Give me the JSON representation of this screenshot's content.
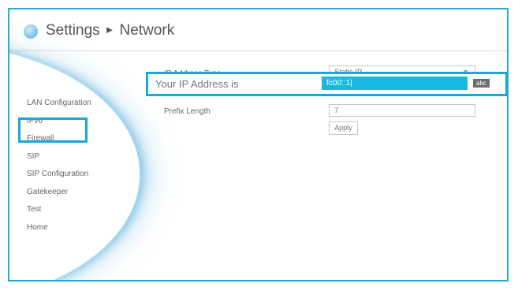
{
  "header": {
    "title": "Settings",
    "separator": "►",
    "section": "Network"
  },
  "menu": {
    "items": [
      {
        "label": "LAN Configuration"
      },
      {
        "label": "IPv6"
      },
      {
        "label": "Firewall"
      },
      {
        "label": "SIP"
      },
      {
        "label": "SIP Configuration"
      },
      {
        "label": "Gatekeeper"
      },
      {
        "label": "Test"
      },
      {
        "label": "Home"
      }
    ],
    "selected": "IPv6"
  },
  "form": {
    "ip_type": {
      "label": "IP Address Type",
      "value": "Static IP"
    },
    "ip_address": {
      "label": "Your IP Address is",
      "value": "fc00::1",
      "input_mode": "abc"
    },
    "prefix_length": {
      "label": "Prefix Length",
      "value": "7"
    },
    "apply_label": "Apply"
  },
  "colors": {
    "accent": "#19a8d8",
    "focus_fill": "#18b9e0",
    "text": "#666666"
  }
}
